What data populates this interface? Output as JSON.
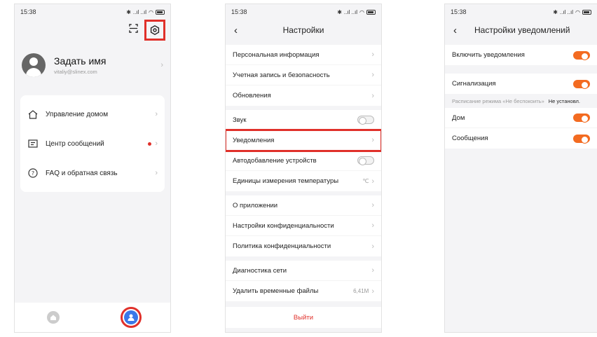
{
  "status": {
    "time": "15:38",
    "signal": "..ıl ..ıl"
  },
  "screen1": {
    "profile": {
      "name": "Задать имя",
      "email": "vitaliy@slinex.com"
    },
    "menu": [
      {
        "label": "Управление домом",
        "icon": "house-icon"
      },
      {
        "label": "Центр сообщений",
        "icon": "message-icon",
        "badge": true
      },
      {
        "label": "FAQ и обратная связь",
        "icon": "help-icon"
      }
    ],
    "icons": {
      "scan": "scan-icon",
      "settings": "settings-icon",
      "home_tab": "home-tab-icon",
      "me_tab": "profile-tab-icon"
    },
    "accent": "#3a78e8",
    "highlight": "#e0302a"
  },
  "screen2": {
    "title": "Настройки",
    "groups": [
      [
        "Персональная информация",
        "Учетная запись и безопасность",
        "Обновления"
      ],
      [
        "Звук",
        "Уведомления",
        "Автодобавление устройств",
        "Единицы измерения температуры"
      ],
      [
        "О приложении",
        "Настройки конфиденциальности",
        "Политика конфиденциальности"
      ],
      [
        "Диагностика сети",
        "Удалить временные файлы"
      ]
    ],
    "temp_unit": "℃",
    "cache_size": "6,41M",
    "logout": "Выйти"
  },
  "screen3": {
    "title": "Настройки уведомлений",
    "enable": "Включить уведомления",
    "alarm": "Сигнализация",
    "dnd_label": "Расписание режима «Не беспокоить»",
    "dnd_value": "Не установл.",
    "home": "Дом",
    "messages": "Сообщения",
    "toggle_color": "#f36b21"
  }
}
